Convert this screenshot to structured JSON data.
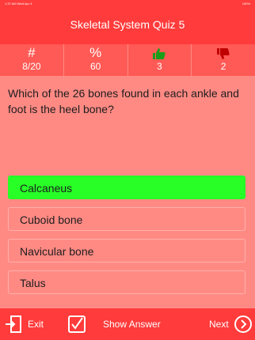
{
  "status_bar": {
    "time": "1:37 AM  Wed Apr 3",
    "battery": "100%"
  },
  "header": {
    "title": "Skeletal System Quiz 5"
  },
  "stats": {
    "number": {
      "symbol": "#",
      "value": "8/20",
      "icon": "hash-icon"
    },
    "percent": {
      "symbol": "%",
      "value": "60",
      "icon": "percent-icon"
    },
    "correct": {
      "value": "3",
      "icon": "thumbs-up-icon",
      "color": "#1a9e1a"
    },
    "wrong": {
      "value": "2",
      "icon": "thumbs-down-icon",
      "color": "#c00000"
    }
  },
  "question": {
    "text": "Which of the 26 bones found in each ankle and foot is the heel bone?"
  },
  "options": [
    {
      "label": "Calcaneus",
      "state": "correct"
    },
    {
      "label": "Cuboid bone",
      "state": "default"
    },
    {
      "label": "Navicular bone",
      "state": "default"
    },
    {
      "label": "Talus",
      "state": "default"
    }
  ],
  "bottom_bar": {
    "exit_label": "Exit",
    "show_answer_label": "Show Answer",
    "next_label": "Next"
  },
  "colors": {
    "header": "#ff3b3b",
    "background": "#ff8a84",
    "correct": "#27ff27"
  }
}
